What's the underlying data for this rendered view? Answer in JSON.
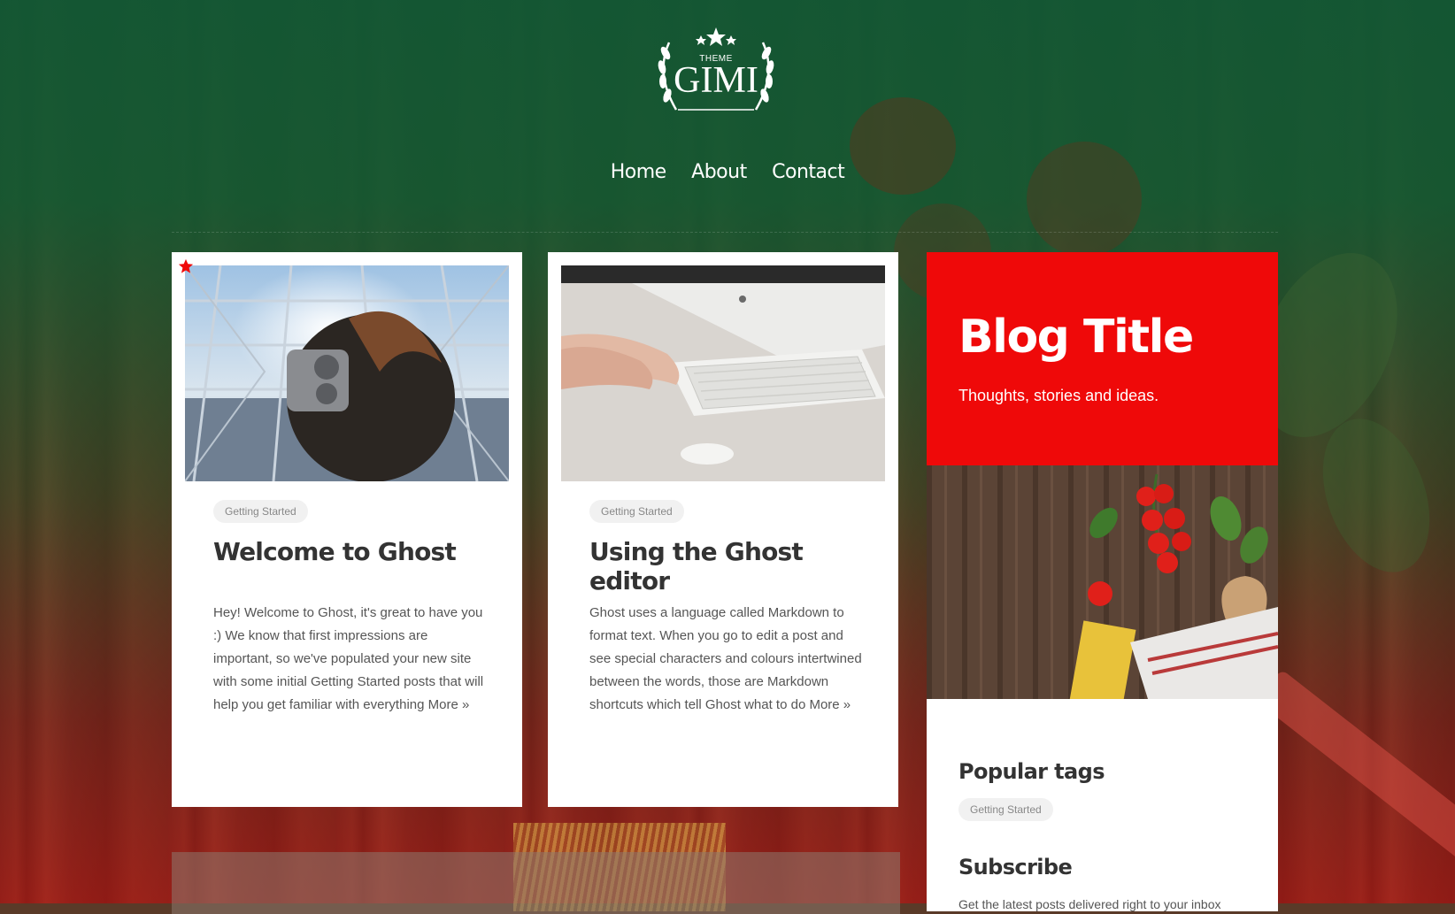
{
  "brand": {
    "theme_label": "THEME",
    "name": "GIMI"
  },
  "nav": {
    "items": [
      {
        "label": "Home"
      },
      {
        "label": "About"
      },
      {
        "label": "Contact"
      }
    ]
  },
  "posts": [
    {
      "tag": "Getting Started",
      "title": "Welcome to Ghost",
      "excerpt": "Hey! Welcome to Ghost, it's great to have you :) We know that first impressions are important, so we've populated your new site with some initial Getting Started posts that will help you get familiar with everything",
      "more": "More »",
      "featured": true,
      "image": "woman-at-observation-deck-binoculars"
    },
    {
      "tag": "Getting Started",
      "title": "Using the Ghost editor",
      "excerpt": "Ghost uses a language called Markdown to format text. When you go to edit a post and see special characters and colours intertwined between the words, those are Markdown shortcuts which tell Ghost what to do",
      "more": "More »",
      "featured": false,
      "image": "hands-typing-on-keyboard"
    }
  ],
  "sidebar": {
    "blog_title": "Blog Title",
    "blog_description": "Thoughts, stories and ideas.",
    "popular_tags_heading": "Popular tags",
    "popular_tags": [
      "Getting Started"
    ],
    "subscribe_heading": "Subscribe",
    "subscribe_text": "Get the latest posts delivered right to your inbox"
  },
  "colors": {
    "accent": "#ef0909",
    "header_green": "#125834",
    "text_dark": "#333333"
  }
}
